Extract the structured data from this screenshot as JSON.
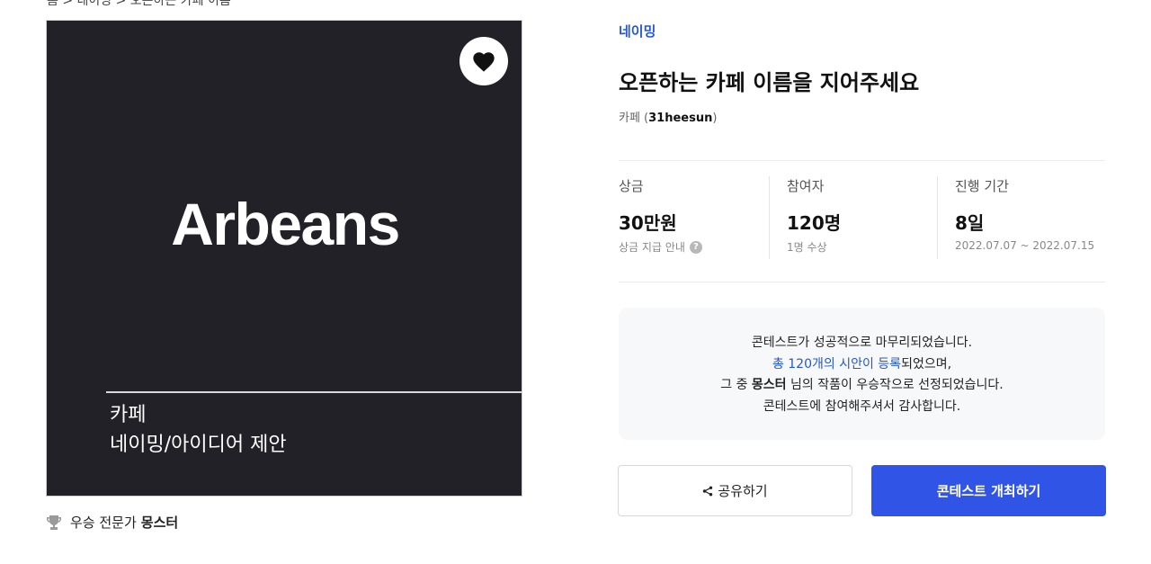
{
  "header": {
    "cut_text": "홈 > 네이밍 > 오픈하는 카페 이름"
  },
  "poster": {
    "brand": "Arbeans",
    "caption_line1": "카페",
    "caption_line2": "네이밍/아이디어 제안"
  },
  "winner": {
    "prefix": "우승 전문가",
    "name": "몽스터"
  },
  "contest": {
    "category": "네이밍",
    "title": "오픈하는 카페 이름을 지어주세요",
    "sub_category": "카페",
    "username": "31heesun"
  },
  "stats": {
    "prize": {
      "label": "상금",
      "value": "30만원",
      "note": "상금 지급 안내"
    },
    "participants": {
      "label": "참여자",
      "value": "120명",
      "note": "1명 수상"
    },
    "period": {
      "label": "진행 기간",
      "value": "8일",
      "note": "2022.07.07 ~ 2022.07.15"
    }
  },
  "notice": {
    "line1": "콘테스트가 성공적으로 마무리되었습니다.",
    "line2_link": "총 120개의 시안이 등록",
    "line2_rest": "되었으며,",
    "line3_prefix": "그 중",
    "line3_name": "몽스터",
    "line3_rest": "님의 작품이 우승작으로 선정되었습니다.",
    "line4": "콘테스트에 참여해주셔서 감사합니다."
  },
  "buttons": {
    "share": "공유하기",
    "host": "콘테스트 개최하기"
  },
  "colors": {
    "accent": "#2356d8",
    "primary_button": "#3055e6",
    "poster_bg": "#212127"
  }
}
